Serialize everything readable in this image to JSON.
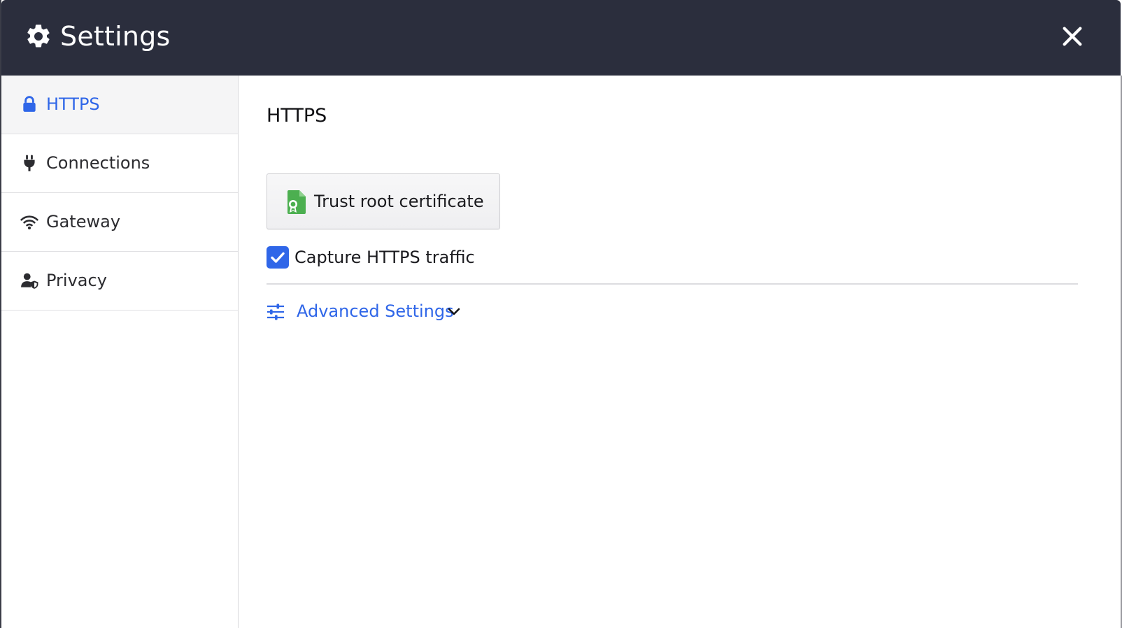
{
  "window": {
    "title": "Settings",
    "icon": "gear-icon",
    "close_icon": "close-icon"
  },
  "sidebar": {
    "items": [
      {
        "label": "HTTPS",
        "icon": "lock-icon",
        "active": true
      },
      {
        "label": "Connections",
        "icon": "plug-icon",
        "active": false
      },
      {
        "label": "Gateway",
        "icon": "wifi-icon",
        "active": false
      },
      {
        "label": "Privacy",
        "icon": "user-shield-icon",
        "active": false
      }
    ]
  },
  "main": {
    "section_title": "HTTPS",
    "trust_button": {
      "label": "Trust root certificate",
      "icon": "certificate-icon"
    },
    "capture_checkbox": {
      "label": "Capture HTTPS traffic",
      "checked": true
    },
    "advanced": {
      "label": "Advanced Settings",
      "icon": "sliders-icon",
      "expanded": false
    }
  },
  "colors": {
    "titlebar": "#2b2e3d",
    "accent": "#2f66e8",
    "certificate": "#4caf50"
  }
}
